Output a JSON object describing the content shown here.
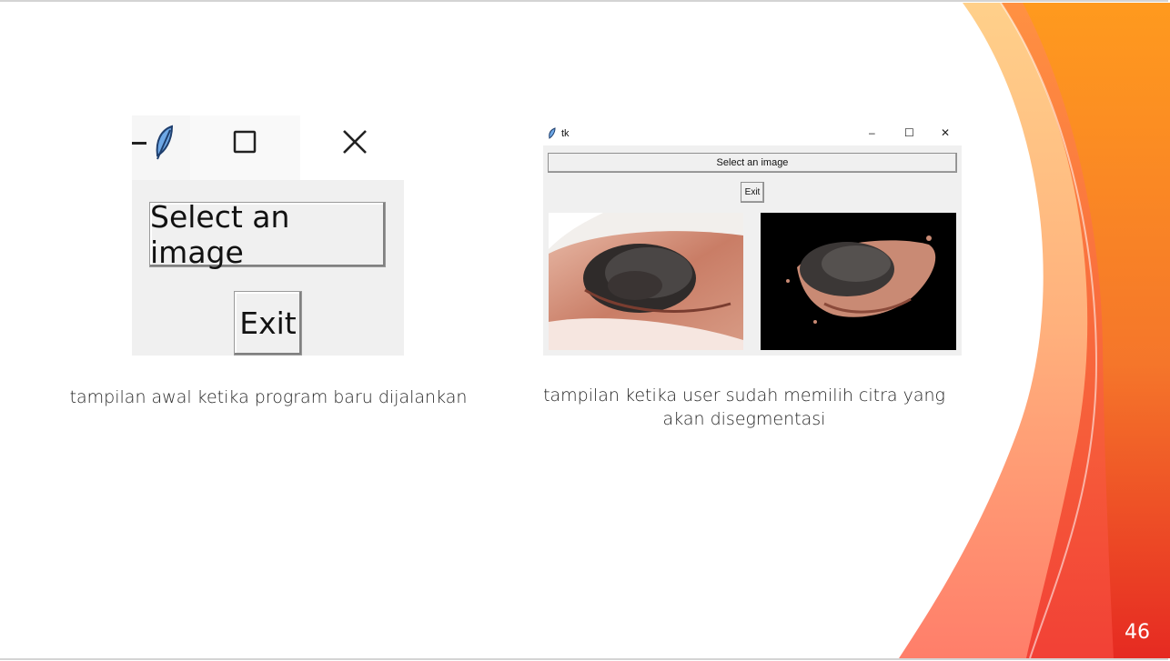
{
  "slide": {
    "page_number": "46",
    "accent_colors": [
      "#FF8A00",
      "#F15A24",
      "#E0201F",
      "#FFC06A"
    ]
  },
  "left_screenshot": {
    "select_button_label": "Select an image",
    "exit_button_label": "Exit",
    "caption": "tampilan awal ketika program baru dijalankan"
  },
  "right_screenshot": {
    "window_title": "tk",
    "select_button_label": "Select an image",
    "exit_button_label": "Exit",
    "caption_line1": "tampilan ketika user sudah memilih citra yang",
    "caption_line2": "akan disegmentasi",
    "minimize_glyph": "–",
    "maximize_glyph": "☐",
    "close_glyph": "✕"
  }
}
